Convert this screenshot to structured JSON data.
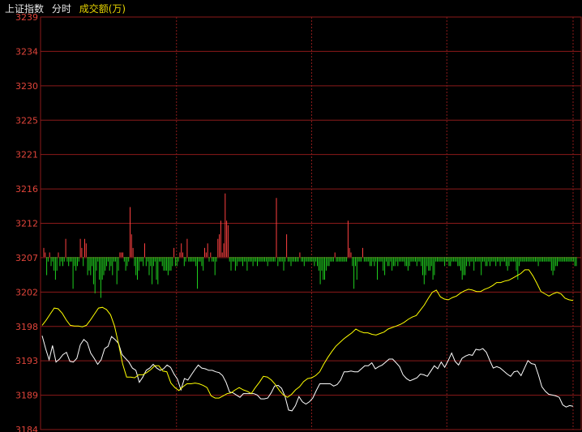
{
  "header": {
    "index_name": "上证指数",
    "mode": "分时",
    "measure": "成交额(万)"
  },
  "colors": {
    "background": "#000000",
    "grid": "#8b1a1a",
    "axis_label": "#e0443a",
    "price_line": "#ffffff",
    "avg_line": "#ffff00",
    "bar_up": "#ff4040",
    "bar_down": "#1fcf1f",
    "header_text": "#e8e8e8",
    "measure_text": "#e6d400"
  },
  "chart_data": {
    "type": "line",
    "ylim": [
      3184,
      3239
    ],
    "base": 3207,
    "y_ticks": [
      "3239",
      "3234",
      "3230",
      "3225",
      "3221",
      "3216",
      "3212",
      "3207",
      "3202",
      "3198",
      "3193",
      "3189",
      "3184"
    ],
    "series": [
      {
        "values": [
          3196.5,
          3194.8,
          3193.3,
          3195.2,
          3193.0,
          3193.4,
          3194.0,
          3194.3,
          3193.1,
          3193.0,
          3193.5,
          3195.3,
          3196.0,
          3195.6,
          3194.2,
          3193.5,
          3192.7,
          3193.3,
          3194.8,
          3195.1,
          3196.4,
          3196.0,
          3195.5,
          3194.0,
          3193.5,
          3193.0,
          3192.2,
          3191.9,
          3190.3,
          3191.0,
          3191.9,
          3192.2,
          3192.7,
          3192.2,
          3191.9,
          3192.1,
          3192.6,
          3192.3,
          3191.4,
          3190.7,
          3189.3,
          3190.8,
          3190.6,
          3191.3,
          3192.0,
          3192.6,
          3192.2,
          3192.1,
          3191.9,
          3191.9,
          3191.7,
          3191.6,
          3191.2,
          3190.3,
          3189.0,
          3188.9,
          3188.6,
          3188.3,
          3188.8,
          3188.8,
          3188.8,
          3188.8,
          3188.6,
          3188.1,
          3188.1,
          3188.2,
          3188.9,
          3189.8,
          3189.9,
          3189.5,
          3188.4,
          3186.6,
          3186.5,
          3187.2,
          3188.4,
          3187.7,
          3187.4,
          3187.7,
          3188.2,
          3189.2,
          3190.1,
          3190.1,
          3190.1,
          3190.1,
          3189.8,
          3190.0,
          3190.6,
          3191.7,
          3191.7,
          3191.8,
          3191.7,
          3191.7,
          3192.1,
          3192.5,
          3192.5,
          3192.9,
          3192.1,
          3192.4,
          3192.6,
          3193.0,
          3193.4,
          3193.4,
          3192.9,
          3192.4,
          3191.3,
          3190.8,
          3190.5,
          3190.7,
          3190.9,
          3191.4,
          3191.3,
          3191.1,
          3191.8,
          3192.5,
          3192.1,
          3193.0,
          3192.3,
          3193.2,
          3194.2,
          3193.1,
          3192.6,
          3193.5,
          3193.8,
          3194.0,
          3193.9,
          3194.7,
          3194.6,
          3194.8,
          3194.3,
          3193.2,
          3192.2,
          3192.4,
          3192.2,
          3191.8,
          3191.4,
          3191.1,
          3191.7,
          3191.8,
          3191.2,
          3192.2,
          3193.2,
          3192.8,
          3192.7,
          3191.3,
          3189.7,
          3189.1,
          3188.7,
          3188.6,
          3188.5,
          3188.3,
          3187.3,
          3187.0,
          3187.2,
          3187.1
        ],
        "color": "white"
      },
      {
        "values": [
          3197.9,
          3198.6,
          3199.4,
          3200.2,
          3200.1,
          3199.5,
          3198.6,
          3197.9,
          3197.8,
          3197.8,
          3197.7,
          3197.9,
          3198.6,
          3199.4,
          3200.2,
          3200.3,
          3200.0,
          3199.3,
          3197.8,
          3195.4,
          3192.8,
          3191.0,
          3191.0,
          3190.9,
          3191.3,
          3191.3,
          3191.6,
          3192.0,
          3192.5,
          3192.5,
          3191.8,
          3191.7,
          3190.2,
          3189.6,
          3189.2,
          3189.7,
          3190.1,
          3190.1,
          3190.2,
          3190.1,
          3189.9,
          3189.6,
          3188.5,
          3188.2,
          3188.2,
          3188.5,
          3188.8,
          3188.9,
          3189.3,
          3189.6,
          3189.3,
          3189.1,
          3188.8,
          3189.6,
          3190.3,
          3191.1,
          3191.0,
          3190.6,
          3190.0,
          3189.2,
          3188.6,
          3188.3,
          3188.7,
          3189.3,
          3189.7,
          3190.4,
          3190.8,
          3190.9,
          3191.2,
          3191.7,
          3192.7,
          3193.6,
          3194.4,
          3195.1,
          3195.6,
          3196.1,
          3196.5,
          3196.9,
          3197.4,
          3197.1,
          3196.9,
          3196.9,
          3196.7,
          3196.6,
          3196.8,
          3197.0,
          3197.4,
          3197.6,
          3197.8,
          3198.0,
          3198.3,
          3198.7,
          3199.0,
          3199.2,
          3199.9,
          3200.6,
          3201.5,
          3202.3,
          3202.6,
          3201.7,
          3201.4,
          3201.3,
          3201.6,
          3201.8,
          3202.2,
          3202.5,
          3202.7,
          3202.6,
          3202.4,
          3202.4,
          3202.7,
          3202.9,
          3203.2,
          3203.6,
          3203.6,
          3203.8,
          3203.9,
          3204.2,
          3204.5,
          3204.8,
          3205.3,
          3205.3,
          3204.5,
          3203.5,
          3202.4,
          3202.1,
          3201.8,
          3202.1,
          3202.3,
          3202.1,
          3201.5,
          3201.3,
          3201.2
        ],
        "color": "yellow"
      }
    ],
    "volume_bars": [
      2,
      1,
      -4,
      -1,
      1,
      -2,
      -1,
      -3,
      -5,
      -3,
      1,
      -2,
      -1,
      -2,
      -1,
      4,
      -1,
      -2,
      -1,
      -1,
      -7,
      -2,
      -3,
      -2,
      -1,
      4,
      2,
      -2,
      4,
      3,
      -4,
      -3,
      -4,
      -2,
      -6,
      -8,
      -3,
      -1,
      -5,
      -9,
      -5,
      -4,
      -3,
      -2,
      -1,
      -3,
      -2,
      -4,
      -1,
      -1,
      -6,
      -3,
      1,
      1,
      1,
      -1,
      -3,
      -2,
      -1,
      11,
      5,
      2,
      -2,
      -4,
      -5,
      -3,
      -1,
      -1,
      -2,
      3,
      -2,
      -1,
      -4,
      -2,
      -6,
      -2,
      -1,
      -5,
      -6,
      -1,
      -1,
      -2,
      -3,
      -3,
      -3,
      -4,
      -3,
      -3,
      -2,
      2,
      -2,
      -2,
      -1,
      1,
      3,
      1,
      -2,
      -1,
      4,
      -1,
      -1,
      -1,
      -1,
      -1,
      -2,
      -7,
      -1,
      -1,
      -2,
      -3,
      2,
      1,
      3,
      -1,
      1,
      -1,
      -1,
      -4,
      -1,
      4,
      5,
      8,
      1,
      3,
      14,
      8,
      7,
      -1,
      -3,
      -1,
      -1,
      -3,
      -2,
      -1,
      -1,
      -1,
      -2,
      -1,
      -1,
      -3,
      -1,
      -1,
      -1,
      -2,
      -1,
      -1,
      -2,
      -1,
      -1,
      -1,
      -1,
      -1,
      -1,
      -2,
      -1,
      -1,
      -1,
      -1,
      -1,
      13,
      -2,
      -1,
      -1,
      -1,
      -3,
      -1,
      5,
      -1,
      -1,
      -2,
      -1,
      -1,
      -1,
      -1,
      -1,
      1,
      -1,
      -1,
      -2,
      -1,
      -1,
      -1,
      -1,
      -1,
      -1,
      -2,
      -1,
      -2,
      -3,
      -6,
      -3,
      -5,
      -5,
      -3,
      -2,
      -2,
      -1,
      -1,
      -1,
      1,
      -1,
      -1,
      -1,
      -1,
      -1,
      -1,
      -1,
      -1,
      8,
      2,
      1,
      -2,
      -7,
      -2,
      -5,
      -1,
      -1,
      -1,
      2,
      -1,
      -1,
      -1,
      -1,
      -2,
      -2,
      -1,
      -2,
      -1,
      -5,
      -1,
      -1,
      -1,
      -3,
      -4,
      -1,
      -2,
      -2,
      -1,
      -3,
      -2,
      -2,
      -1,
      -2,
      -1,
      -1,
      -1,
      -1,
      -2,
      -2,
      -3,
      -2,
      -1,
      -1,
      -1,
      -1,
      -2,
      -1,
      -1,
      -2,
      -4,
      -6,
      -4,
      -2,
      -3,
      -3,
      -2,
      -5,
      -4,
      -1,
      -1,
      -1,
      -1,
      -1,
      -1,
      -2,
      -1,
      -1,
      -2,
      -2,
      -1,
      -1,
      -1,
      -1,
      -2,
      -2,
      -3,
      -5,
      -4,
      -4,
      -2,
      -1,
      -2,
      -1,
      -1,
      -3,
      -1,
      -1,
      -1,
      -1,
      -4,
      -1,
      -1,
      -2,
      -2,
      -1,
      -2,
      -1,
      -1,
      -1,
      -2,
      -1,
      -1,
      -2,
      -1,
      -1,
      -1,
      -2,
      -3,
      -2,
      -1,
      -1,
      -1,
      -1,
      -3,
      -5,
      -2,
      -1,
      -1,
      -1,
      -1,
      -1,
      -1,
      -1,
      -1,
      -1,
      -1,
      -1,
      -1,
      -2,
      -1,
      -1,
      -1,
      -1,
      -1,
      -1,
      -1,
      -1,
      -3,
      -4,
      -3,
      -2,
      -2,
      -1,
      -1,
      -1,
      -1,
      -1,
      -1,
      -1,
      -1,
      -1,
      -1,
      -1,
      -2,
      -2
    ]
  }
}
